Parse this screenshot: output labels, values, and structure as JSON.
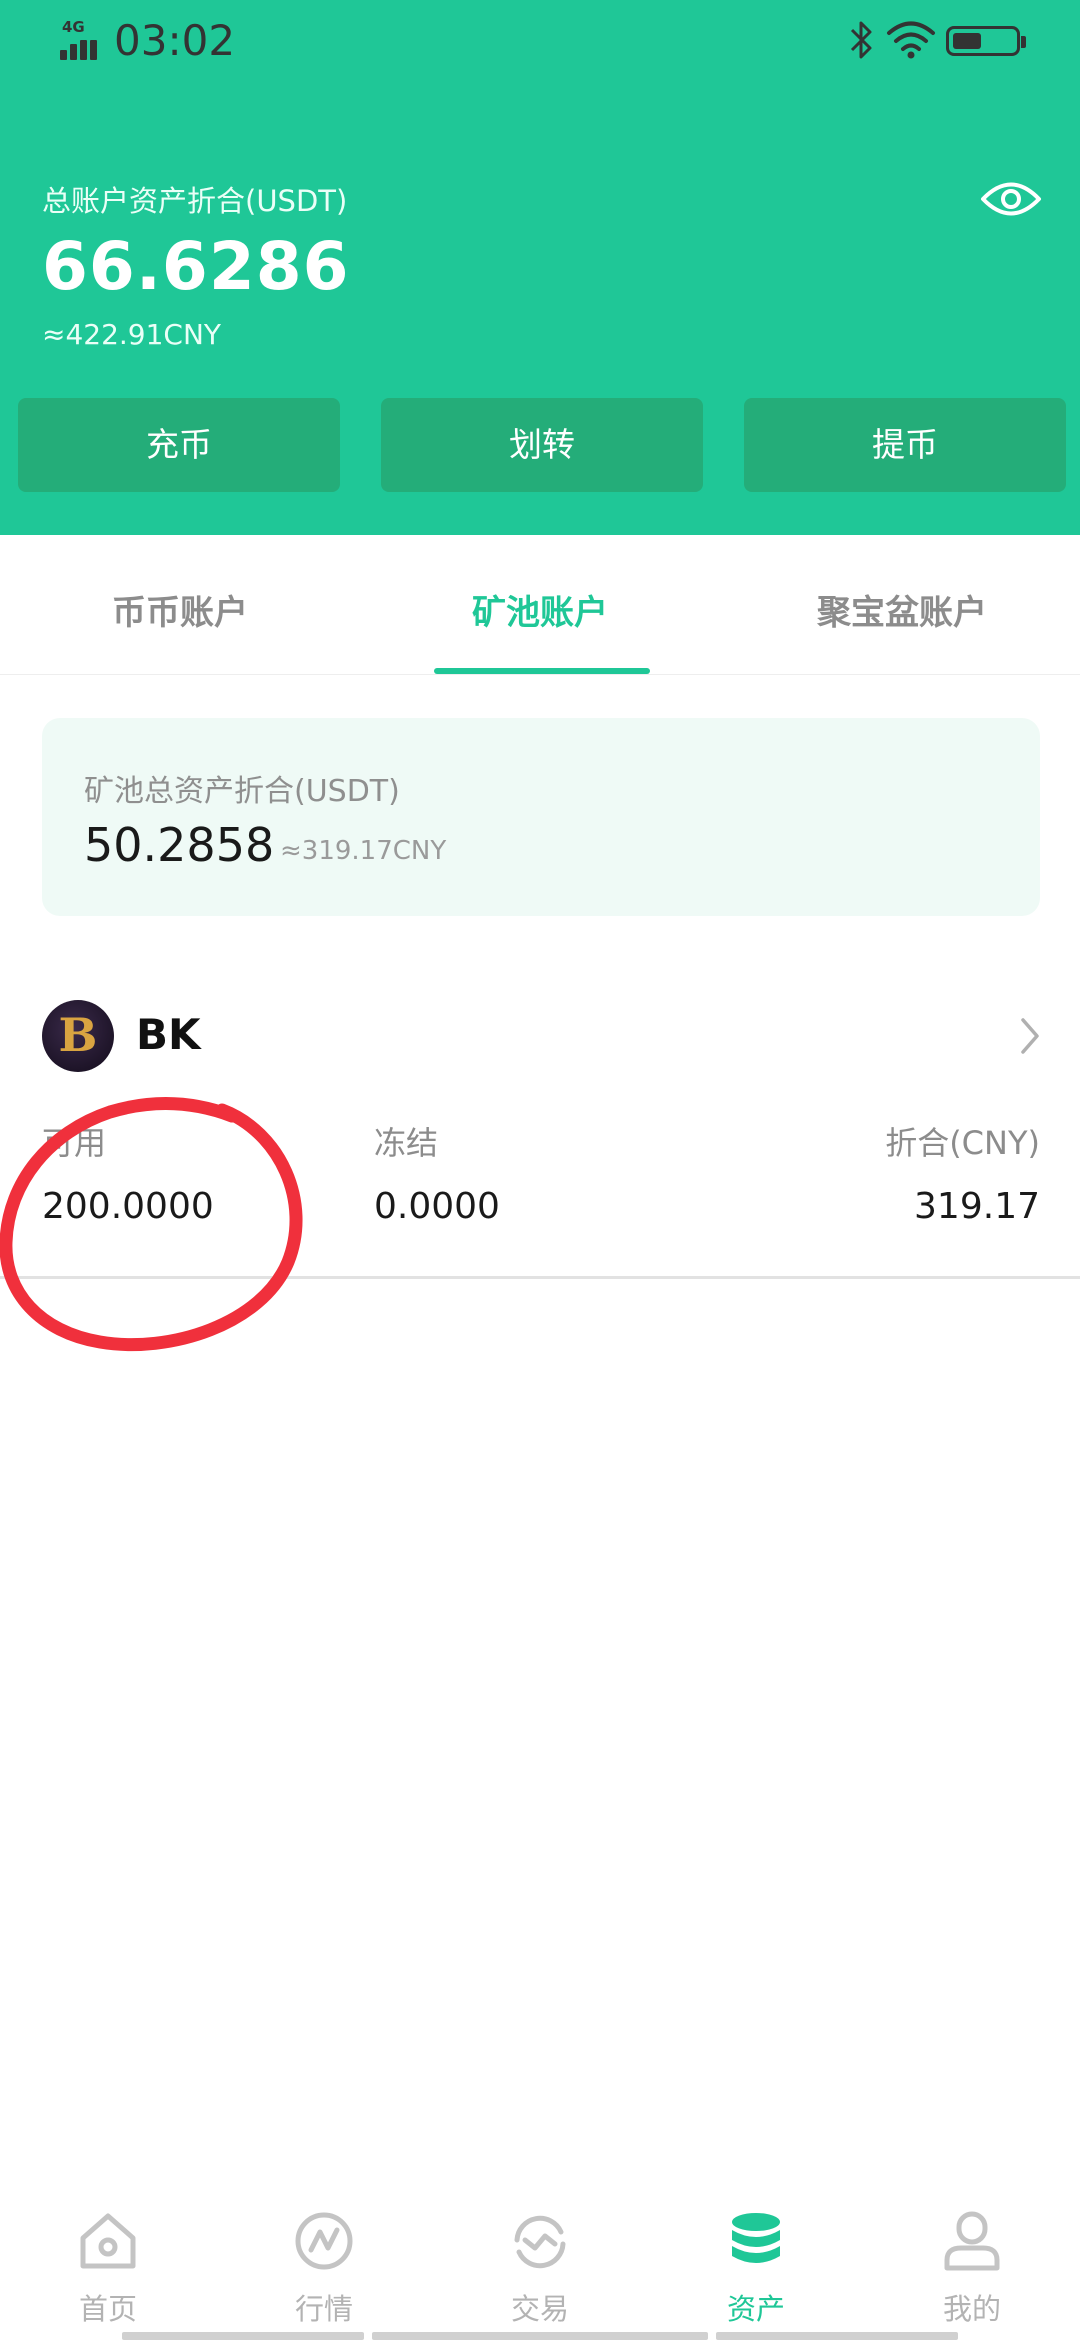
{
  "status_bar": {
    "network": "4G",
    "time": "03:02"
  },
  "header": {
    "total_label": "总账户资产折合(USDT)",
    "total_value": "66.6286",
    "total_cny": "≈422.91CNY",
    "actions": {
      "deposit": "充币",
      "transfer": "划转",
      "withdraw": "提币"
    }
  },
  "tabs": [
    {
      "label": "币币账户",
      "active": false
    },
    {
      "label": "矿池账户",
      "active": true
    },
    {
      "label": "聚宝盆账户",
      "active": false
    }
  ],
  "pool_card": {
    "label": "矿池总资产折合(USDT)",
    "value": "50.2858",
    "cny": "≈319.17CNY"
  },
  "coin": {
    "avatar_letter": "B",
    "name": "BK",
    "headers": {
      "available": "可用",
      "frozen": "冻结",
      "cny": "折合(CNY)"
    },
    "values": {
      "available": "200.0000",
      "frozen": "0.0000",
      "cny": "319.17"
    }
  },
  "bottom_nav": [
    {
      "label": "首页",
      "icon": "home-icon",
      "active": false
    },
    {
      "label": "行情",
      "icon": "market-icon",
      "active": false
    },
    {
      "label": "交易",
      "icon": "trade-icon",
      "active": false
    },
    {
      "label": "资产",
      "icon": "assets-icon",
      "active": true
    },
    {
      "label": "我的",
      "icon": "profile-icon",
      "active": false
    }
  ],
  "colors": {
    "brand_green": "#1fc797",
    "button_green": "#24ad79",
    "annotation_red": "#f0303c"
  }
}
